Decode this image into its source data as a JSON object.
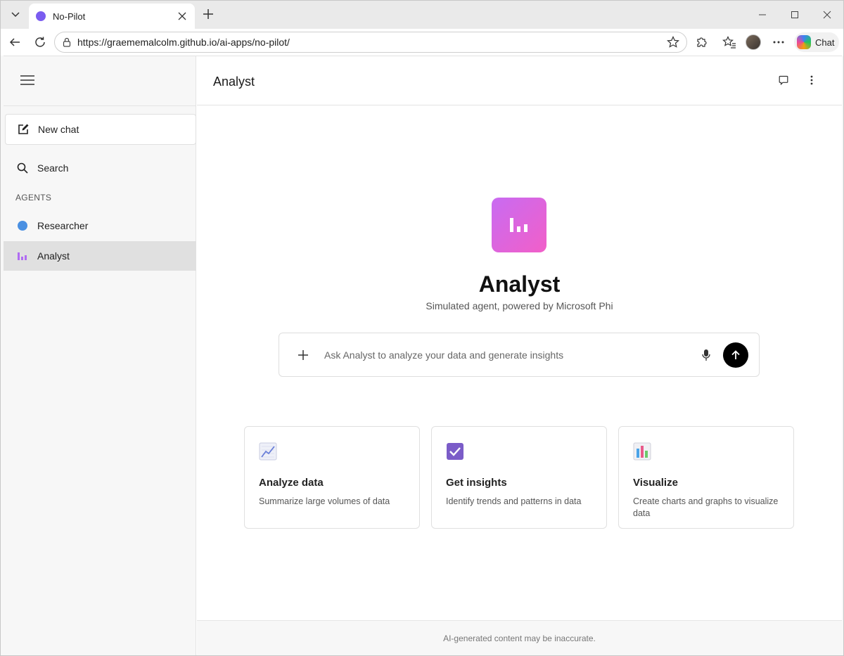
{
  "browser": {
    "tab_title": "No-Pilot",
    "url": "https://graememalcolm.github.io/ai-apps/no-pilot/",
    "copilot_label": "Chat"
  },
  "sidebar": {
    "new_chat": "New chat",
    "search": "Search",
    "section_label": "AGENTS",
    "agents": [
      {
        "label": "Researcher",
        "icon": "blue-dot-icon",
        "color": "#4a90e2"
      },
      {
        "label": "Analyst",
        "icon": "bar-chart-icon",
        "color": "#b06cf2"
      }
    ]
  },
  "main": {
    "header_title": "Analyst",
    "hero_title": "Analyst",
    "hero_subtitle": "Simulated agent, powered by Microsoft Phi",
    "composer_placeholder": "Ask Analyst to analyze your data and generate insights",
    "cards": [
      {
        "title": "Analyze data",
        "desc": "Summarize large volumes of data",
        "icon": "line-chart-icon"
      },
      {
        "title": "Get insights",
        "desc": "Identify trends and patterns in data",
        "icon": "checkbox-icon"
      },
      {
        "title": "Visualize",
        "desc": "Create charts and graphs to visualize data",
        "icon": "bar-chart-icon"
      }
    ],
    "footer": "AI-generated content may be inaccurate."
  },
  "colors": {
    "accent_gradient_start": "#c86bf2",
    "accent_gradient_end": "#f25fc8",
    "active_item_bg": "#e0e0e0"
  }
}
